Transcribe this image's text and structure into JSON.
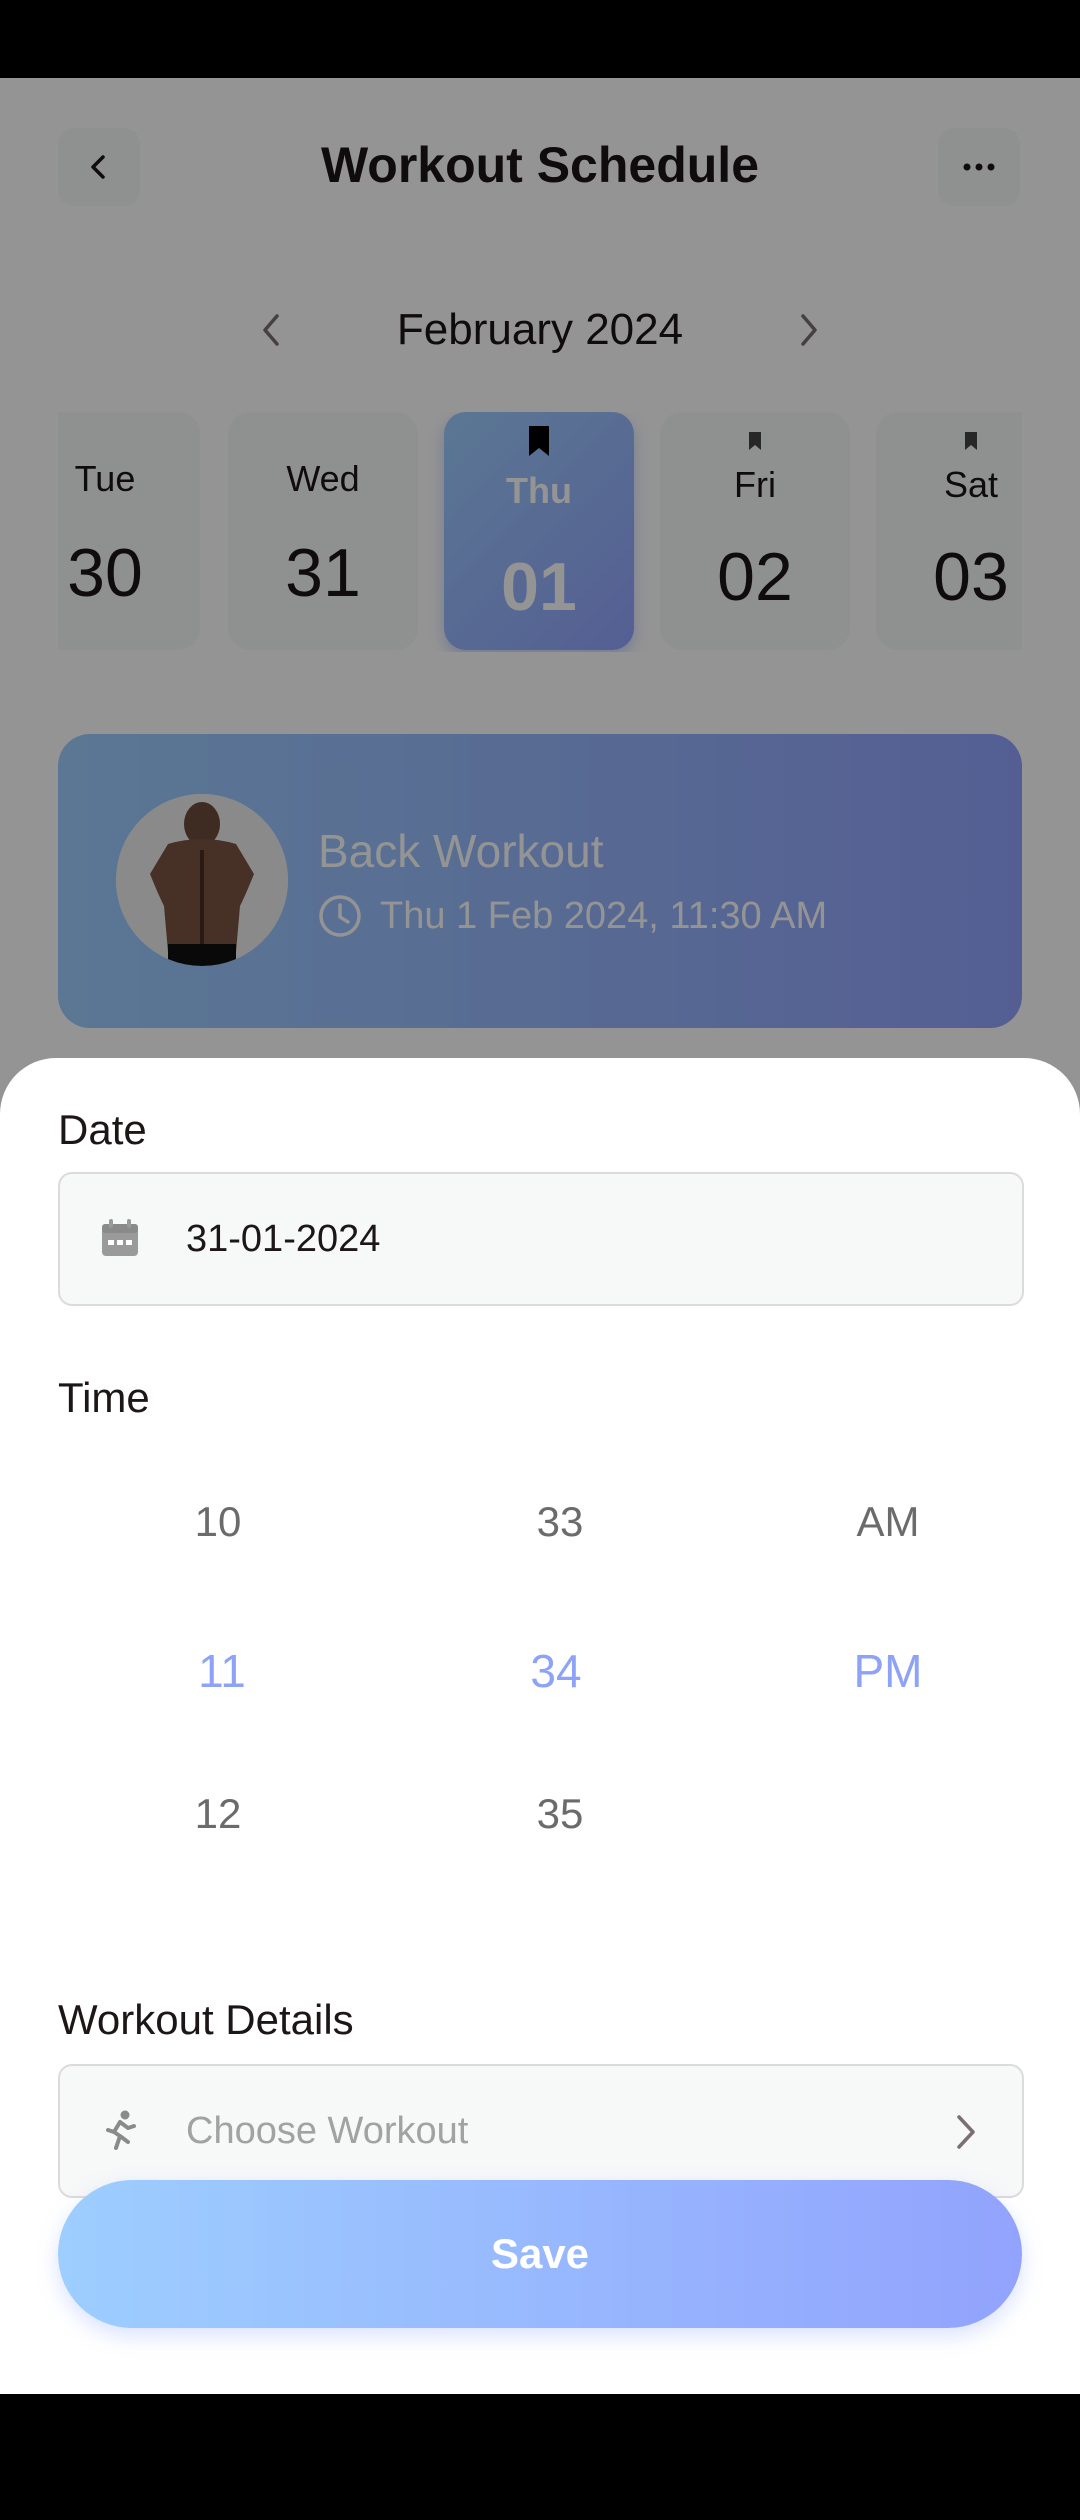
{
  "header": {
    "title": "Workout Schedule"
  },
  "calendar": {
    "month": "February 2024",
    "days": [
      {
        "name": "Tue",
        "num": "30"
      },
      {
        "name": "Wed",
        "num": "31"
      },
      {
        "name": "Thu",
        "num": "01"
      },
      {
        "name": "Fri",
        "num": "02"
      },
      {
        "name": "Sat",
        "num": "03"
      }
    ]
  },
  "workout_card": {
    "name": "Back Workout",
    "time": "Thu 1 Feb 2024, 11:30 AM"
  },
  "sheet": {
    "date_label": "Date",
    "date_value": "31-01-2024",
    "time_label": "Time",
    "hours": [
      "10",
      "11",
      "12"
    ],
    "minutes": [
      "33",
      "34",
      "35"
    ],
    "periods": [
      "AM",
      "PM"
    ],
    "details_label": "Workout Details",
    "workout_placeholder": "Choose Workout",
    "save_label": "Save"
  },
  "colors": {
    "accent_start": "#9dceff",
    "accent_end": "#92a3fd",
    "selected_text": "#8ea2f7"
  }
}
